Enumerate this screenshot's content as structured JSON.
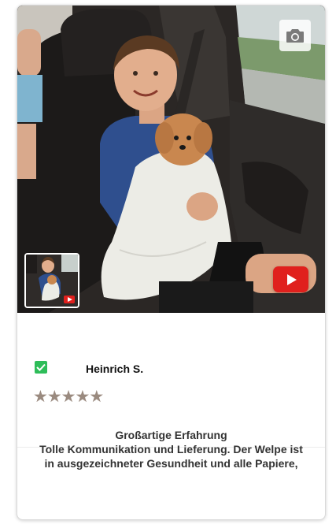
{
  "review_card": {
    "media": {
      "camera_icon": "camera-icon",
      "play_icon": "youtube-play-icon",
      "play_color": "#e0201d"
    },
    "reviewer": {
      "name": "Heinrich S.",
      "verified_icon": "checkbox-checked-icon",
      "verified_color": "#2ebd59"
    },
    "rating": {
      "stars": 5,
      "max": 5,
      "star_color": "#9a8a7f"
    },
    "review": {
      "title": "Großartige Erfahrung",
      "body": "Tolle Kommunikation und Lieferung. Der Welpe ist in ausgezeichneter Gesundheit und alle Papiere,"
    }
  }
}
